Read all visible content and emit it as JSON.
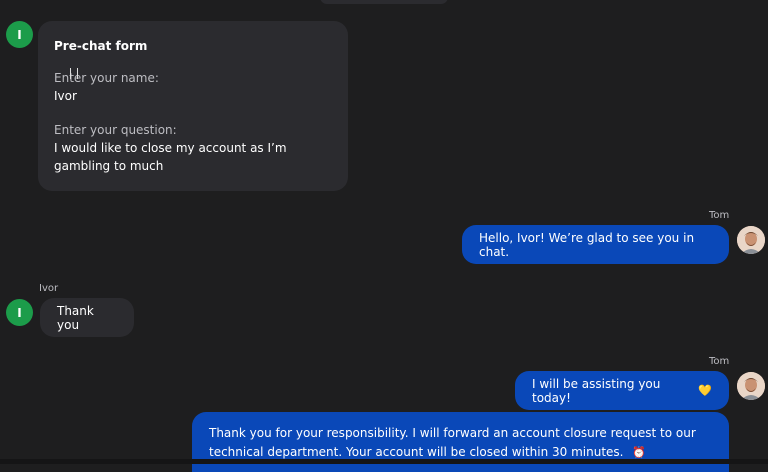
{
  "prechat": {
    "avatar_initial": "I",
    "title": "Pre-chat form",
    "name_label": "Enter your name:",
    "name_value": "Ivor",
    "question_label": "Enter your question:",
    "question_value": "I would like to close my account as I’m gambling to much"
  },
  "messages": [
    {
      "sender": "Tom",
      "text": "Hello, Ivor! We’re glad to see you in chat.",
      "direction": "outgoing"
    },
    {
      "sender": "Ivor",
      "avatar_initial": "I",
      "text": "Thank you",
      "direction": "incoming"
    },
    {
      "sender": "Tom",
      "text": "I will be assisting you today!",
      "emoji": "💛",
      "direction": "outgoing"
    },
    {
      "text": "Thank you for your responsibility. I will forward an account closure request to our technical department. Your account will be closed within 30 minutes.",
      "emoji": "⏰",
      "direction": "outgoing"
    }
  ],
  "colors": {
    "background": "#1e1e1f",
    "incoming_bubble": "#2b2b2f",
    "outgoing_bubble": "#0a48b8",
    "user_avatar": "#1c9c4a"
  }
}
